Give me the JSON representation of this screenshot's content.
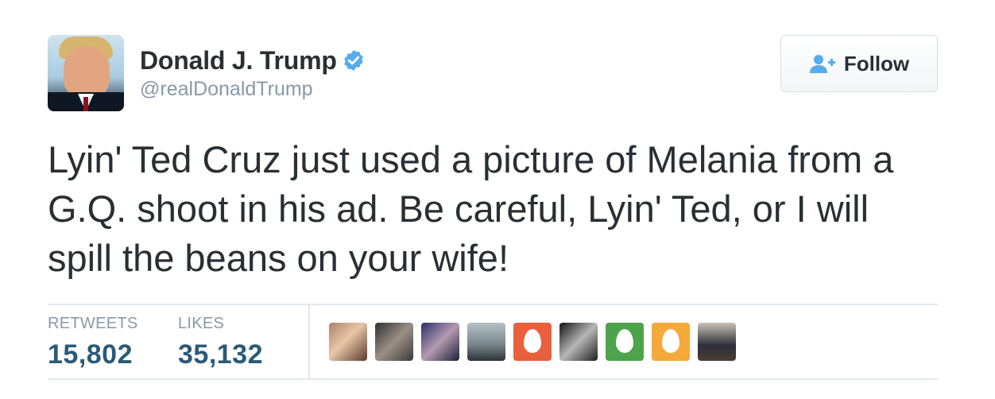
{
  "user": {
    "display_name": "Donald J. Trump",
    "handle": "@realDonaldTrump",
    "verified": true
  },
  "follow_button": {
    "label": "Follow"
  },
  "tweet": {
    "text": "Lyin' Ted Cruz just used a picture of Melania from a G.Q. shoot in his ad. Be careful, Lyin' Ted, or I will spill the beans on your wife!"
  },
  "stats": {
    "retweets_label": "RETWEETS",
    "retweets_value": "15,802",
    "likes_label": "LIKES",
    "likes_value": "35,132"
  },
  "likers": [
    {
      "type": "photo"
    },
    {
      "type": "photo"
    },
    {
      "type": "photo"
    },
    {
      "type": "photo"
    },
    {
      "type": "egg",
      "color": "#e8603c"
    },
    {
      "type": "photo"
    },
    {
      "type": "egg",
      "color": "#4ca34c"
    },
    {
      "type": "egg",
      "color": "#f5a93a"
    },
    {
      "type": "photo"
    }
  ],
  "colors": {
    "verified_badge": "#55acee",
    "follow_icon": "#55acee",
    "stat_value": "#2b5a77",
    "muted_text": "#8899a6",
    "divider": "#e1e8ed"
  }
}
